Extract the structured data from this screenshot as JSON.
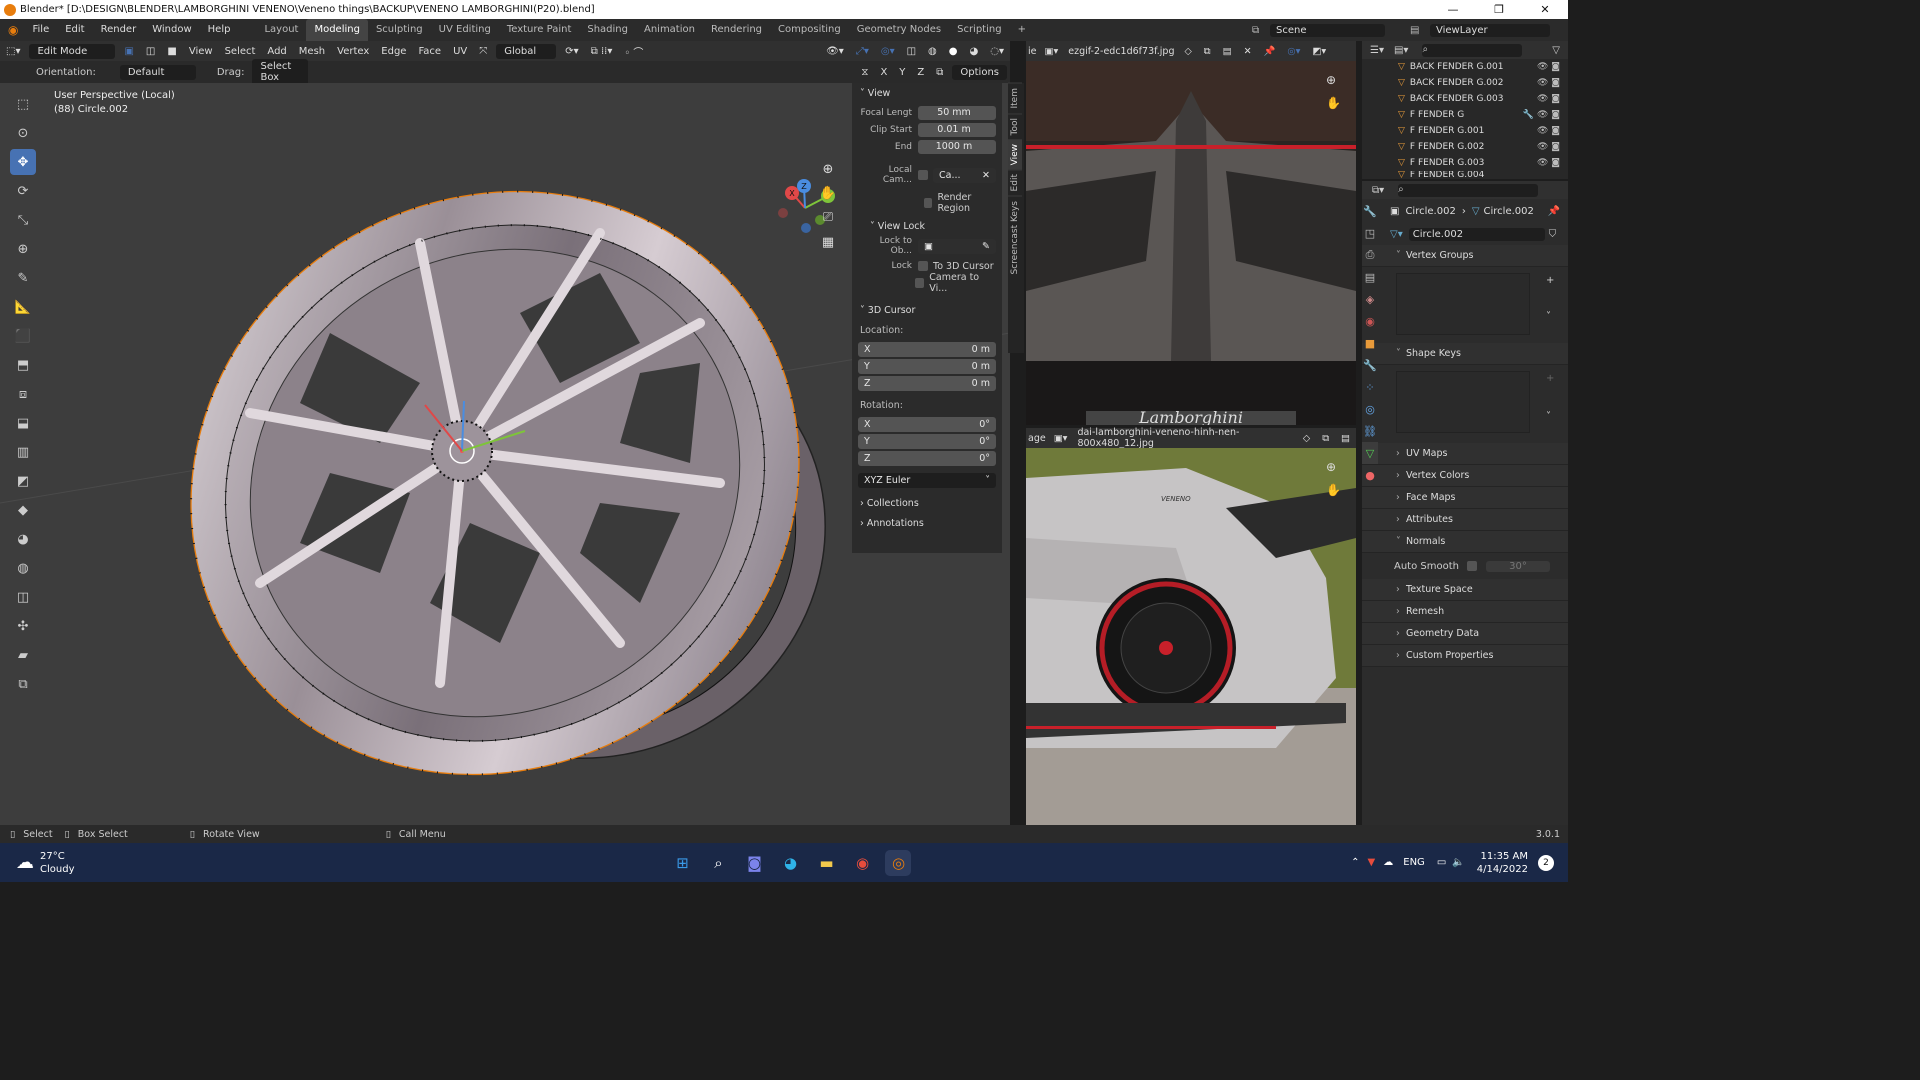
{
  "window": {
    "title": "Blender* [D:\\DESIGN\\BLENDER\\LAMBORGHINI VENENO\\Veneno things\\BACKUP\\VENENO LAMBORGHINI(P20).blend]",
    "minimize": "—",
    "maximize": "❐",
    "close": "✕"
  },
  "menu": [
    "File",
    "Edit",
    "Render",
    "Window",
    "Help"
  ],
  "workspaces": {
    "tabs": [
      "Layout",
      "Modeling",
      "Sculpting",
      "UV Editing",
      "Texture Paint",
      "Shading",
      "Animation",
      "Rendering",
      "Compositing",
      "Geometry Nodes",
      "Scripting"
    ],
    "active": "Modeling",
    "add": "+"
  },
  "scene": {
    "name": "Scene",
    "view_layer": "ViewLayer"
  },
  "viewport_header": {
    "mode": "Edit Mode",
    "menus": [
      "View",
      "Select",
      "Add",
      "Mesh",
      "Vertex",
      "Edge",
      "Face",
      "UV"
    ],
    "transform_orientation": "Global"
  },
  "tool_settings": {
    "orientation_label": "Orientation:",
    "orientation_value": "Default",
    "drag_label": "Drag:",
    "drag_value": "Select Box",
    "axes": [
      "X",
      "Y",
      "Z"
    ],
    "options": "Options"
  },
  "viewport": {
    "perspective": "User Perspective (Local)",
    "object": "(88) Circle.002"
  },
  "npanel": {
    "view_header": "View",
    "focal_length_label": "Focal Lengt",
    "focal_length": "50 mm",
    "clip_start_label": "Clip Start",
    "clip_start": "0.01 m",
    "end_label": "End",
    "clip_end": "1000 m",
    "local_camera_label": "Local Cam...",
    "local_camera_value": "Ca...",
    "render_region": "Render Region",
    "view_lock_header": "View Lock",
    "lock_to_object_label": "Lock to Ob...",
    "lock_label": "Lock",
    "to_3d_cursor": "To 3D Cursor",
    "camera_to_view": "Camera to Vi...",
    "cursor_header": "3D Cursor",
    "location_label": "Location:",
    "location": {
      "x": "0 m",
      "y": "0 m",
      "z": "0 m"
    },
    "rotation_label": "Rotation:",
    "rotation": {
      "x": "0°",
      "y": "0°",
      "z": "0°"
    },
    "rotation_mode": "XYZ Euler",
    "collections": "Collections",
    "annotations": "Annotations"
  },
  "sidebar_tabs": [
    "Item",
    "Tool",
    "View",
    "Edit",
    "Screencast Keys"
  ],
  "axis_labels": {
    "x": "X",
    "y": "Y",
    "z": "Z"
  },
  "image_editor_1": {
    "filename": "ezgif-2-edc1d6f73f.jpg",
    "prefix": "ie",
    "brand_text": "Lamborghini"
  },
  "image_editor_2": {
    "filename": "dai-lamborghini-veneno-hinh-nen-800x480_12.jpg",
    "prefix": "age",
    "car_text": "VENENO"
  },
  "outliner": {
    "items": [
      "BACK FENDER G.001",
      "BACK FENDER G.002",
      "BACK FENDER G.003",
      "F FENDER G",
      "F FENDER G.001",
      "F FENDER G.002",
      "F FENDER G.003",
      "F FENDER G.004"
    ]
  },
  "properties": {
    "breadcrumb_object": "Circle.002",
    "breadcrumb_mesh": "Circle.002",
    "mesh_name": "Circle.002",
    "sections": {
      "vertex_groups": "Vertex Groups",
      "shape_keys": "Shape Keys",
      "uv_maps": "UV Maps",
      "vertex_colors": "Vertex Colors",
      "face_maps": "Face Maps",
      "attributes": "Attributes",
      "normals": "Normals",
      "texture_space": "Texture Space",
      "remesh": "Remesh",
      "geometry_data": "Geometry Data",
      "custom_properties": "Custom Properties"
    },
    "auto_smooth_label": "Auto Smooth",
    "auto_smooth_angle": "30°"
  },
  "statusbar": {
    "select": "Select",
    "box_select": "Box Select",
    "rotate_view": "Rotate View",
    "call_menu": "Call Menu",
    "version": "3.0.1"
  },
  "taskbar": {
    "temperature": "27°C",
    "weather": "Cloudy",
    "language": "ENG",
    "time": "11:35 AM",
    "date": "4/14/2022",
    "notifications": "2"
  },
  "colors": {
    "accent": "#4772b3",
    "orange": "#e87d0d",
    "viewport_bg": "#3d3d3d",
    "taskbar": "#1a2847"
  }
}
